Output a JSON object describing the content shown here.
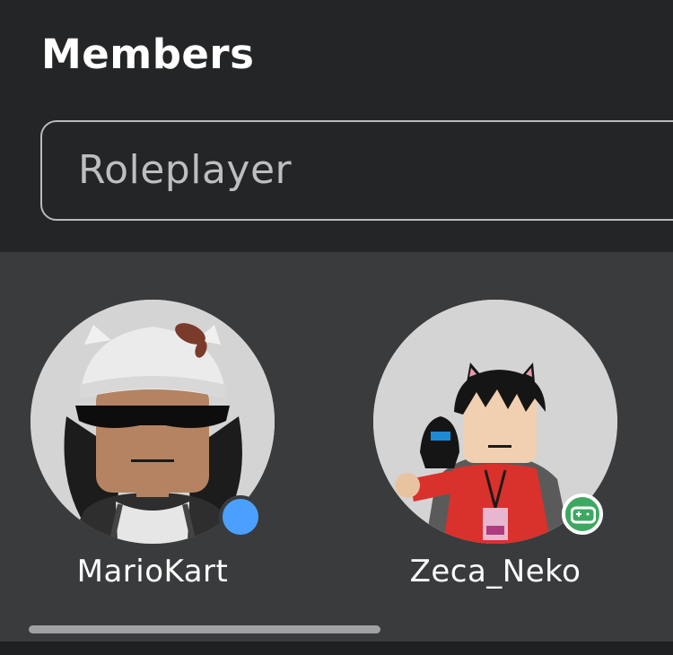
{
  "header": {
    "title": "Members"
  },
  "search": {
    "value": "Roleplayer"
  },
  "members": [
    {
      "name": "MarioKart",
      "status": "online",
      "status_color": "#4ba0ff"
    },
    {
      "name": "Zeca_Neko",
      "status": "in-game",
      "status_color": "#3da861"
    }
  ],
  "colors": {
    "header_bg": "#232527",
    "panel_bg": "#393b3d",
    "text": "#ffffff",
    "search_text": "#bdbec0"
  }
}
